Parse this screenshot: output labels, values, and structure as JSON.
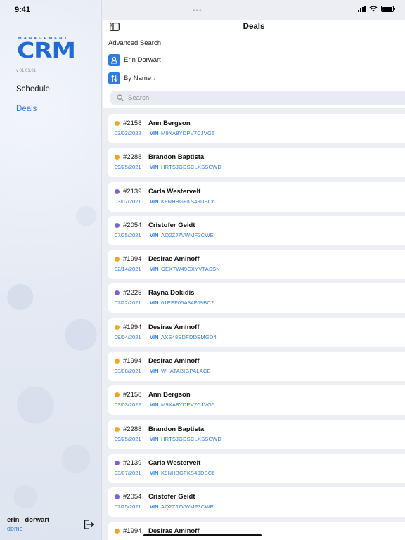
{
  "status_bar": {
    "time": "9:41",
    "dots": "•••"
  },
  "sidebar": {
    "logo_top": "MANAGEMENT",
    "logo_main": "CRM",
    "version": "v 01.01.01",
    "nav": [
      {
        "label": "Schedule",
        "active": false
      },
      {
        "label": "Deals",
        "active": true
      }
    ],
    "user": {
      "name": "erin _dorwart",
      "role": "demo"
    }
  },
  "header": {
    "title": "Deals",
    "advanced_search": "Advanced Search",
    "user_filter": "Erin Dorwart",
    "sort_label": "By Name ↓",
    "search_placeholder": "Search"
  },
  "colors": {
    "accent": "#2f7be0",
    "orange": "#f0a823",
    "purple": "#7566d6"
  },
  "deals": [
    {
      "num": "#2158",
      "name": "Ann Bergson",
      "date": "03/03/2022",
      "vin_label": "VIN",
      "vin": "M9XA8YDPV7CJVG5",
      "status": "orange"
    },
    {
      "num": "#2288",
      "name": "Brandon Baptista",
      "date": "09/25/2021",
      "vin_label": "VIN",
      "vin": "HRTSJGDSCLXSSCWD",
      "status": "orange"
    },
    {
      "num": "#2139",
      "name": "Carla Westervelt",
      "date": "03/07/2021",
      "vin_label": "VIN",
      "vin": "K9NHBGFKS49DSC6",
      "status": "purple"
    },
    {
      "num": "#2054",
      "name": "Cristofer Geidt",
      "date": "07/25/2021",
      "vin_label": "VIN",
      "vin": "AQ2ZJ7VWMF3CWE",
      "status": "purple"
    },
    {
      "num": "#1994",
      "name": "Desirae Aminoff",
      "date": "02/14/2021",
      "vin_label": "VIN",
      "vin": "GEXTW49CXYVTASSN",
      "status": "orange"
    },
    {
      "num": "#2225",
      "name": "Rayna Dokidis",
      "date": "07/22/2021",
      "vin_label": "VIN",
      "vin": "61EEF05A34F09BC2",
      "status": "purple"
    },
    {
      "num": "#1994",
      "name": "Desirae Aminoff",
      "date": "09/04/2021",
      "vin_label": "VIN",
      "vin": "AXS48SDFDDEMGD4",
      "status": "orange"
    },
    {
      "num": "#1994",
      "name": "Desirae Aminoff",
      "date": "03/08/2021",
      "vin_label": "VIN",
      "vin": "WHATABIGPALACE",
      "status": "orange"
    },
    {
      "num": "#2158",
      "name": "Ann Bergson",
      "date": "03/03/2022",
      "vin_label": "VIN",
      "vin": "M9XA8YDPV7CJVG5",
      "status": "orange"
    },
    {
      "num": "#2288",
      "name": "Brandon Baptista",
      "date": "09/25/2021",
      "vin_label": "VIN",
      "vin": "HRTSJGDSCLXSSCWD",
      "status": "orange"
    },
    {
      "num": "#2139",
      "name": "Carla Westervelt",
      "date": "03/07/2021",
      "vin_label": "VIN",
      "vin": "K9NHBGFKS49DSC6",
      "status": "purple"
    },
    {
      "num": "#2054",
      "name": "Cristofer Geidt",
      "date": "07/25/2021",
      "vin_label": "VIN",
      "vin": "AQ2ZJ7VWMF3CWE",
      "status": "purple"
    },
    {
      "num": "#1994",
      "name": "Desirae Aminoff",
      "date": "",
      "vin_label": "",
      "vin": "",
      "status": "orange"
    }
  ]
}
